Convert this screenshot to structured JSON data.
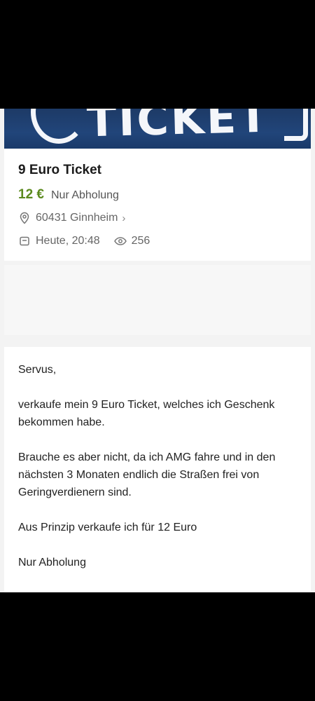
{
  "hero": {
    "text": "TICKET"
  },
  "listing": {
    "title": "9 Euro Ticket",
    "price": "12 €",
    "pickup": "Nur Abholung",
    "location": "60431 Ginnheim",
    "location_chevron": "›",
    "posted": "Heute, 20:48",
    "views": "256"
  },
  "description": {
    "p1": "Servus,",
    "p2": "verkaufe mein 9 Euro Ticket, welches ich Geschenk bekommen habe.",
    "p3": "Brauche es aber nicht, da ich AMG fahre und in den nächsten 3 Monaten endlich die Straßen frei von Geringverdienern sind.",
    "p4": "Aus Prinzip verkaufe ich für 12 Euro",
    "p5": "Nur Abholung"
  },
  "icons": [
    "location-pin-icon",
    "calendar-icon",
    "eye-icon",
    "chevron-right-icon"
  ],
  "colors": {
    "price": "#5b8a1e",
    "hero_bg": "#1d3a66"
  }
}
